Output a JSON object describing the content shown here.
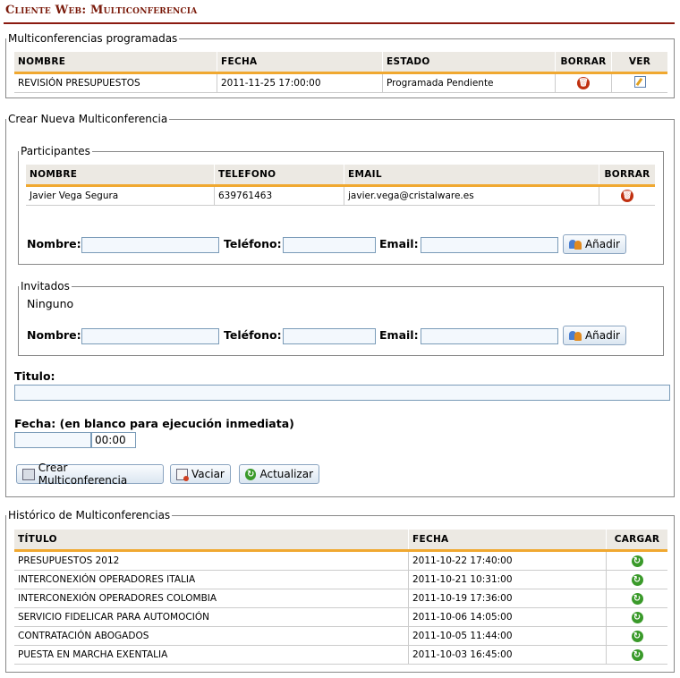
{
  "page_title": "Cliente Web: Multiconferencia",
  "scheduled": {
    "legend": "Multiconferencias programadas",
    "headers": [
      "NOMBRE",
      "FECHA",
      "ESTADO",
      "BORRAR",
      "VER"
    ],
    "rows": [
      {
        "nombre": "REVISIÓN PRESUPUESTOS",
        "fecha": "2011-11-25 17:00:00",
        "estado": "Programada Pendiente"
      }
    ]
  },
  "create": {
    "legend": "Crear Nueva Multiconferencia",
    "participants": {
      "legend": "Participantes",
      "headers": [
        "NOMBRE",
        "TELEFONO",
        "EMAIL",
        "BORRAR"
      ],
      "rows": [
        {
          "nombre": "Javier Vega Segura",
          "telefono": "639761463",
          "email": "javier.vega@cristalware.es"
        }
      ],
      "nombre_label": "Nombre:",
      "telefono_label": "Teléfono:",
      "email_label": "Email:",
      "add_label": "Añadir"
    },
    "guests": {
      "legend": "Invitados",
      "empty_text": "Ninguno",
      "nombre_label": "Nombre:",
      "telefono_label": "Teléfono:",
      "email_label": "Email:",
      "add_label": "Añadir"
    },
    "titulo_label": "Titulo:",
    "titulo_value": "",
    "fecha_label": "Fecha: (en blanco para ejecución inmediata)",
    "fecha_value": "",
    "hora_value": "00:00",
    "buttons": {
      "create": "Crear Multiconferencia",
      "clear": "Vaciar",
      "refresh": "Actualizar"
    }
  },
  "history": {
    "legend": "Histórico de Multiconferencias",
    "headers": [
      "TÍTULO",
      "FECHA",
      "CARGAR"
    ],
    "rows": [
      {
        "titulo": "PRESUPUESTOS 2012",
        "fecha": "2011-10-22 17:40:00"
      },
      {
        "titulo": "INTERCONEXIÓN OPERADORES ITALIA",
        "fecha": "2011-10-21 10:31:00"
      },
      {
        "titulo": "INTERCONEXIÓN OPERADORES COLOMBIA",
        "fecha": "2011-10-19 17:36:00"
      },
      {
        "titulo": "SERVICIO FIDELICAR PARA AUTOMOCIÓN",
        "fecha": "2011-10-06 14:05:00"
      },
      {
        "titulo": "CONTRATACIÓN ABOGADOS",
        "fecha": "2011-10-05 11:44:00"
      },
      {
        "titulo": "PUESTA EN MARCHA EXENTALIA",
        "fecha": "2011-10-03 16:45:00"
      }
    ]
  },
  "colors": {
    "title": "#7a1a0a",
    "header_rule": "#f0a830",
    "delete_icon": "#c03010",
    "load_icon": "#3a9a2a"
  }
}
